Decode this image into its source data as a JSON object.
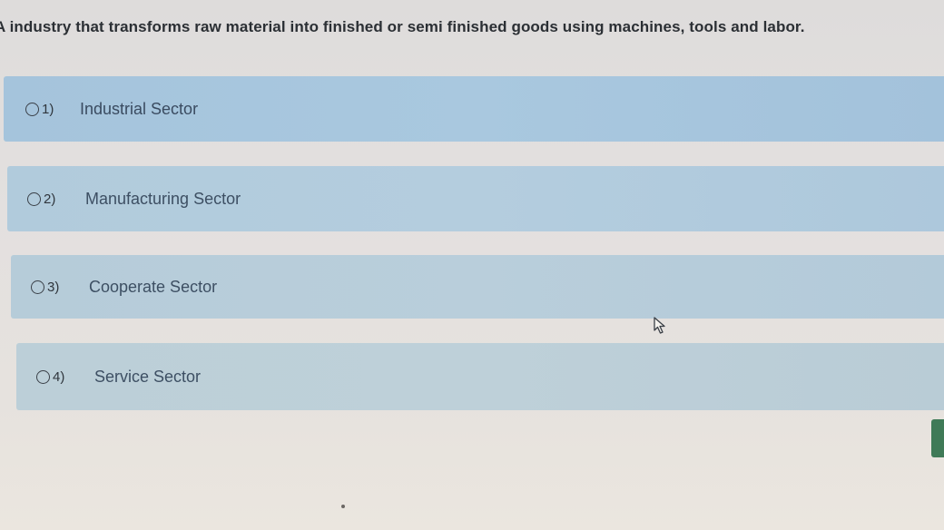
{
  "question": {
    "text": "A industry that transforms raw material into finished or semi finished goods using machines, tools and labor."
  },
  "options": [
    {
      "number": "1)",
      "label": "Industrial Sector"
    },
    {
      "number": "2)",
      "label": "Manufacturing Sector"
    },
    {
      "number": "3)",
      "label": "Cooperate Sector"
    },
    {
      "number": "4)",
      "label": "Service Sector"
    }
  ],
  "icons": {
    "cursor": "mouse-pointer-icon"
  },
  "colors": {
    "option_background": "#a9c8df",
    "accent_button": "#3f7a57"
  }
}
